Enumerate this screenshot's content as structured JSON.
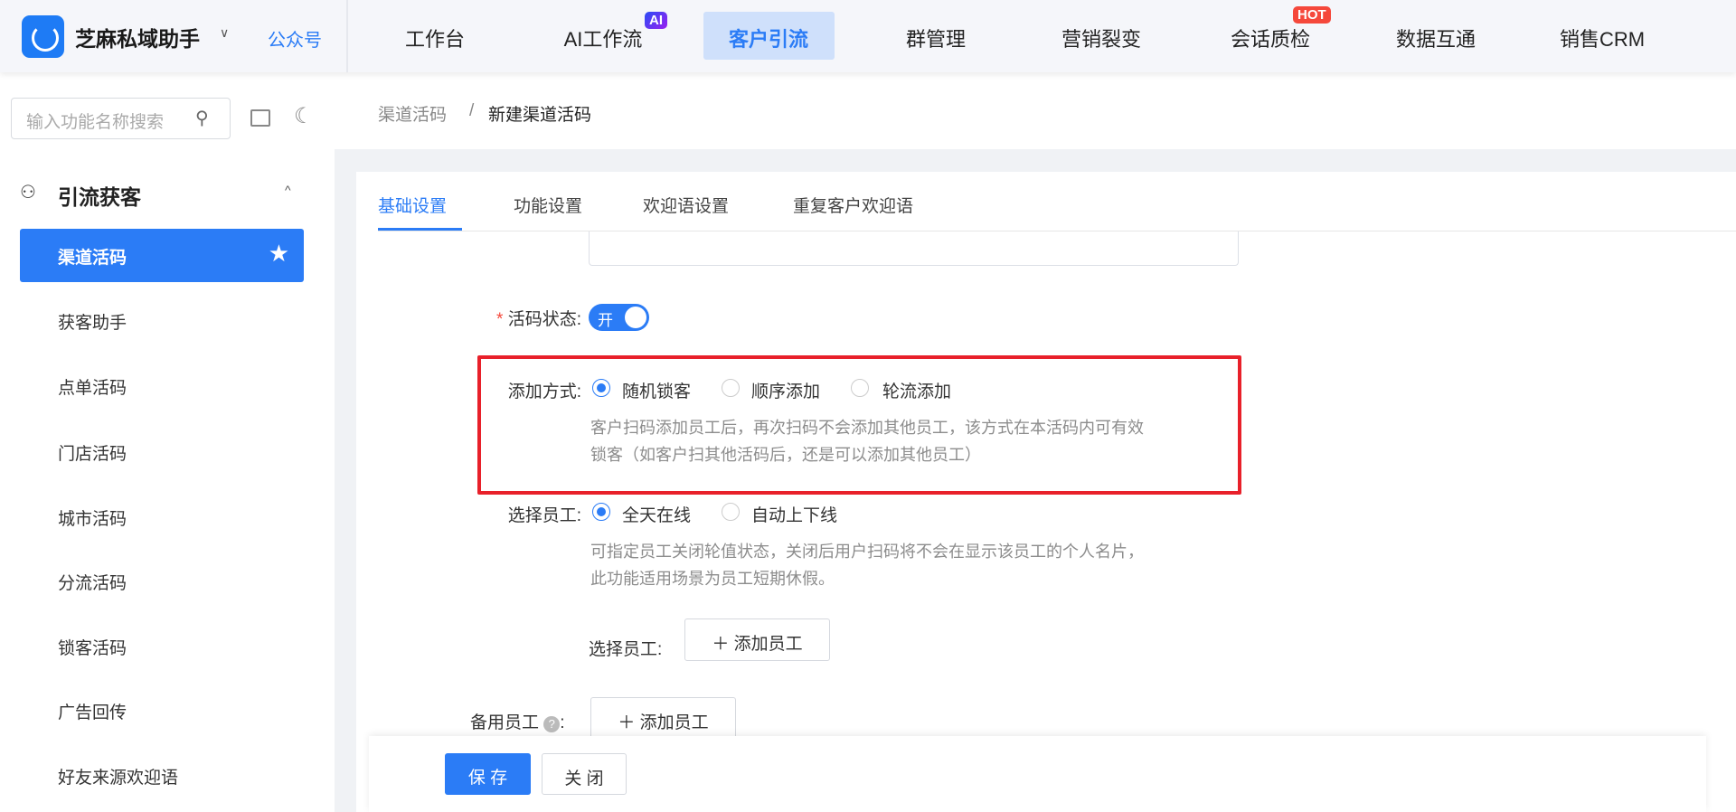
{
  "topbar": {
    "brand": "芝麻私域助手",
    "account": "公众号",
    "nav": [
      {
        "label": "工作台"
      },
      {
        "label": "AI工作流",
        "badge": "AI"
      },
      {
        "label": "客户引流",
        "active": true
      },
      {
        "label": "群管理"
      },
      {
        "label": "营销裂变"
      },
      {
        "label": "会话质检",
        "badge": "HOT"
      },
      {
        "label": "数据互通"
      },
      {
        "label": "销售CRM"
      }
    ]
  },
  "sidebar": {
    "search_placeholder": "输入功能名称搜索",
    "group": "引流获客",
    "items": [
      {
        "label": "渠道活码",
        "active": true
      },
      {
        "label": "获客助手"
      },
      {
        "label": "点单活码"
      },
      {
        "label": "门店活码"
      },
      {
        "label": "城市活码"
      },
      {
        "label": "分流活码"
      },
      {
        "label": "锁客活码"
      },
      {
        "label": "广告回传"
      },
      {
        "label": "好友来源欢迎语"
      }
    ]
  },
  "breadcrumb": {
    "parent": "渠道活码",
    "sep": "/",
    "current": "新建渠道活码"
  },
  "tabs": [
    {
      "label": "基础设置",
      "active": true
    },
    {
      "label": "功能设置"
    },
    {
      "label": "欢迎语设置"
    },
    {
      "label": "重复客户欢迎语"
    }
  ],
  "form": {
    "status": {
      "label": "活码状态:",
      "toggle_text": "开",
      "on": true
    },
    "add_mode": {
      "label": "添加方式:",
      "options": [
        "随机锁客",
        "顺序添加",
        "轮流添加"
      ],
      "selected": "随机锁客",
      "help1": "客户扫码添加员工后，再次扫码不会添加其他员工，该方式在本活码内可有效",
      "help2": "锁客（如客户扫其他活码后，还是可以添加其他员工）"
    },
    "staff": {
      "label": "选择员工:",
      "options": [
        "全天在线",
        "自动上下线"
      ],
      "selected": "全天在线",
      "help1": "可指定员工关闭轮值状态，关闭后用户扫码将不会在显示该员工的个人名片，",
      "help2": "此功能适用场景为员工短期休假。",
      "sub_label": "选择员工:",
      "add_button": "添加员工"
    },
    "backup": {
      "label": "备用员工",
      "colon": ":",
      "add_button": "添加员工"
    }
  },
  "footer": {
    "save": "保 存",
    "close": "关 闭"
  },
  "colors": {
    "primary": "#2b7cf6",
    "highlight_box": "#e8202a"
  }
}
